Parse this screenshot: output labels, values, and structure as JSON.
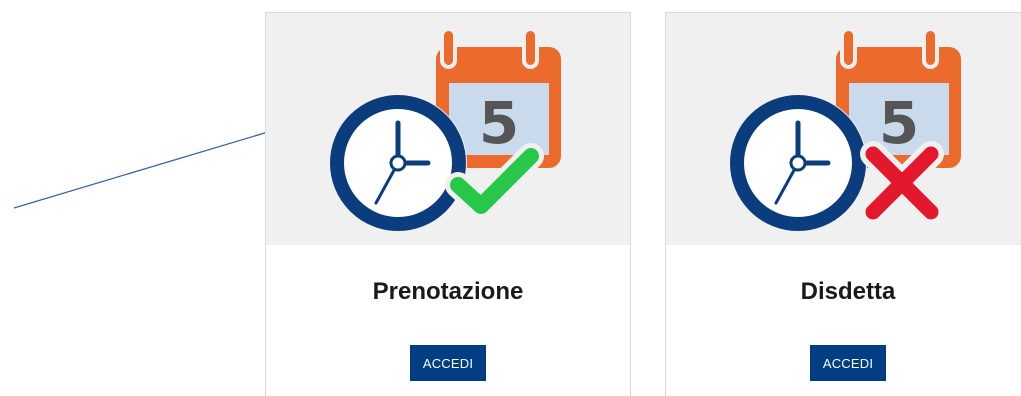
{
  "cards": [
    {
      "title": "Prenotazione",
      "calendar_day": "5",
      "status_icon": "checkmark-icon",
      "button_label": "ACCEDI"
    },
    {
      "title": "Disdetta",
      "calendar_day": "5",
      "status_icon": "cross-icon",
      "button_label": "ACCEDI"
    }
  ],
  "colors": {
    "card_image_bg": "#f0f0f0",
    "calendar_orange": "#ec6a2b",
    "calendar_page": "#c8daeb",
    "clock_navy": "#0b3d7e",
    "check_green": "#27c84a",
    "cross_red": "#e3182d",
    "button_blue": "#003e83",
    "arrow_blue": "#3b5fae"
  }
}
